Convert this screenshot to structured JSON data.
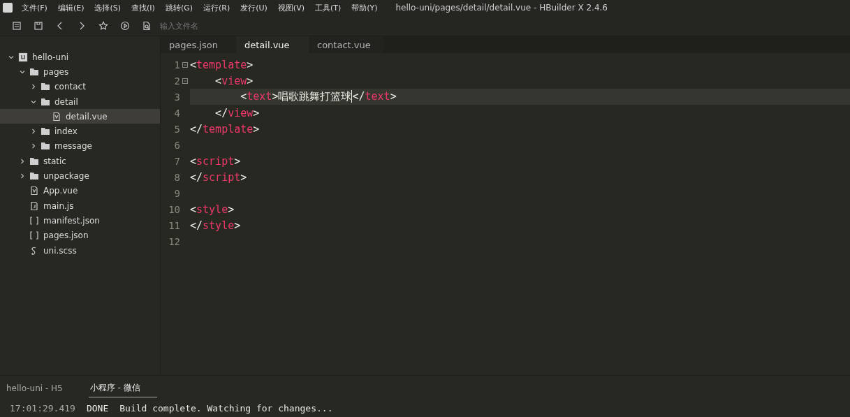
{
  "window": {
    "title": "hello-uni/pages/detail/detail.vue - HBuilder X 2.4.6"
  },
  "menu": [
    "文件(F)",
    "编辑(E)",
    "选择(S)",
    "查找(I)",
    "跳转(G)",
    "运行(R)",
    "发行(U)",
    "视图(V)",
    "工具(T)",
    "帮助(Y)"
  ],
  "toolbar": {
    "search": {
      "placeholder": "输入文件名"
    }
  },
  "tree": [
    {
      "label": "hello-uni",
      "kind": "project",
      "expanded": true,
      "selected": false,
      "children": [
        {
          "label": "pages",
          "kind": "folder",
          "expanded": true,
          "selected": false,
          "children": [
            {
              "label": "contact",
              "kind": "folder",
              "expanded": false,
              "selected": false
            },
            {
              "label": "detail",
              "kind": "folder",
              "expanded": true,
              "selected": false,
              "children": [
                {
                  "label": "detail.vue",
                  "kind": "vue",
                  "selected": true
                }
              ]
            },
            {
              "label": "index",
              "kind": "folder",
              "expanded": false,
              "selected": false
            },
            {
              "label": "message",
              "kind": "folder",
              "expanded": false,
              "selected": false
            }
          ]
        },
        {
          "label": "static",
          "kind": "folder",
          "expanded": false,
          "selected": false
        },
        {
          "label": "unpackage",
          "kind": "folder",
          "expanded": false,
          "selected": false
        },
        {
          "label": "App.vue",
          "kind": "vue",
          "selected": false
        },
        {
          "label": "main.js",
          "kind": "js",
          "selected": false
        },
        {
          "label": "manifest.json",
          "kind": "json",
          "selected": false
        },
        {
          "label": "pages.json",
          "kind": "json",
          "selected": false
        },
        {
          "label": "uni.scss",
          "kind": "scss",
          "selected": false
        }
      ]
    }
  ],
  "editor_tabs": [
    {
      "label": "pages.json",
      "selected": false
    },
    {
      "label": "detail.vue",
      "selected": true
    },
    {
      "label": "contact.vue",
      "selected": false
    }
  ],
  "code": [
    {
      "number": "1",
      "foldable": true,
      "current": false,
      "tokens": [
        {
          "kind": "punct",
          "text": "<"
        },
        {
          "kind": "tag",
          "text": "template"
        },
        {
          "kind": "punct",
          "text": ">"
        }
      ]
    },
    {
      "number": "2",
      "foldable": true,
      "current": false,
      "tokens": [
        {
          "kind": "punct",
          "text": "    <"
        },
        {
          "kind": "tag",
          "text": "view"
        },
        {
          "kind": "punct",
          "text": ">"
        }
      ]
    },
    {
      "number": "3",
      "foldable": false,
      "current": true,
      "tokens": [
        {
          "kind": "punct",
          "text": "        <"
        },
        {
          "kind": "tag",
          "text": "text"
        },
        {
          "kind": "punct",
          "text": ">"
        },
        {
          "kind": "text",
          "text": "唱歌跳舞打篮球"
        },
        {
          "kind": "cursor",
          "text": "</"
        },
        {
          "kind": "tag",
          "text": "text"
        },
        {
          "kind": "punct",
          "text": ">"
        }
      ]
    },
    {
      "number": "4",
      "foldable": false,
      "current": false,
      "tokens": [
        {
          "kind": "punct",
          "text": "    </"
        },
        {
          "kind": "tag",
          "text": "view"
        },
        {
          "kind": "punct",
          "text": ">"
        }
      ]
    },
    {
      "number": "5",
      "foldable": false,
      "current": false,
      "tokens": [
        {
          "kind": "punct",
          "text": "</"
        },
        {
          "kind": "tag",
          "text": "template"
        },
        {
          "kind": "punct",
          "text": ">"
        }
      ]
    },
    {
      "number": "6",
      "foldable": false,
      "current": false
    },
    {
      "number": "7",
      "foldable": false,
      "current": false,
      "tokens": [
        {
          "kind": "punct",
          "text": "<"
        },
        {
          "kind": "tag",
          "text": "script"
        },
        {
          "kind": "punct",
          "text": ">"
        }
      ]
    },
    {
      "number": "8",
      "foldable": false,
      "current": false,
      "tokens": [
        {
          "kind": "punct",
          "text": "</"
        },
        {
          "kind": "tag",
          "text": "script"
        },
        {
          "kind": "punct",
          "text": ">"
        }
      ]
    },
    {
      "number": "9",
      "foldable": false,
      "current": false
    },
    {
      "number": "10",
      "foldable": false,
      "current": false,
      "tokens": [
        {
          "kind": "punct",
          "text": "<"
        },
        {
          "kind": "tag",
          "text": "style"
        },
        {
          "kind": "punct",
          "text": ">"
        }
      ]
    },
    {
      "number": "11",
      "foldable": false,
      "current": false,
      "tokens": [
        {
          "kind": "punct",
          "text": "</"
        },
        {
          "kind": "tag",
          "text": "style"
        },
        {
          "kind": "punct",
          "text": ">"
        }
      ]
    },
    {
      "number": "12",
      "foldable": false,
      "current": false
    }
  ],
  "console_tabs": [
    {
      "label": "hello-uni - H5",
      "selected": false
    },
    {
      "label": "小程序 - 微信",
      "selected": true
    }
  ],
  "console": [
    {
      "time": "17:01:29.419",
      "status": "DONE",
      "message": "Build complete. Watching for changes..."
    }
  ]
}
